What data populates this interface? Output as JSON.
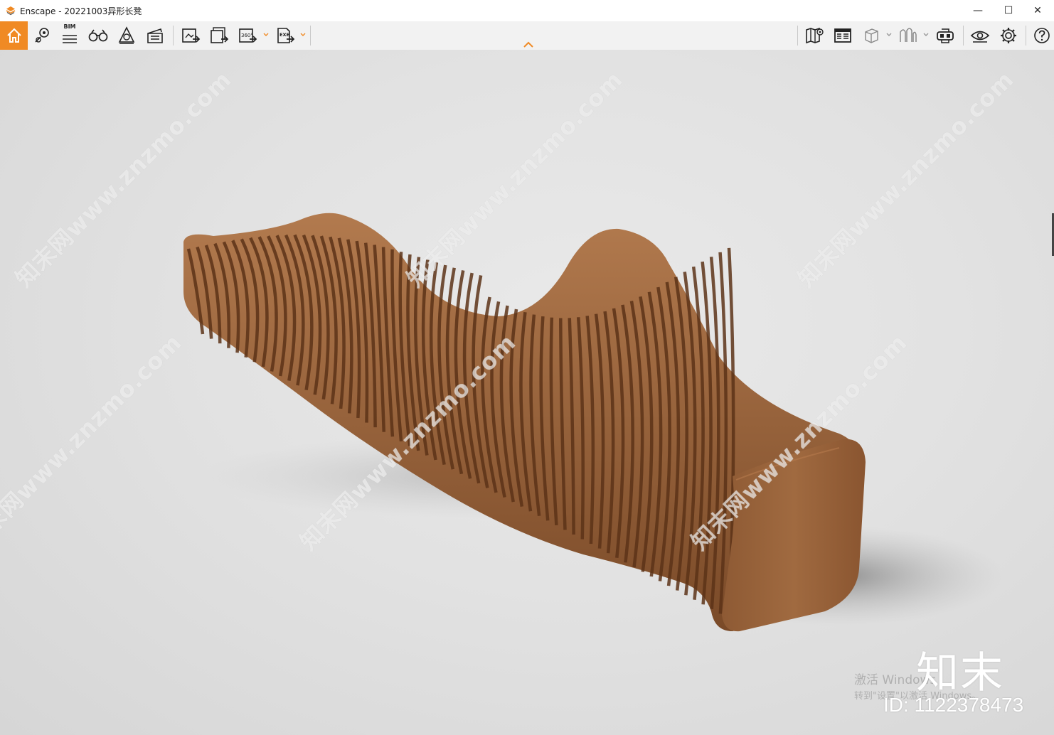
{
  "window": {
    "title": "Enscape - 20221003异形长凳",
    "controls": {
      "minimize": "—",
      "maximize": "☐",
      "close": "✕"
    }
  },
  "toolbar": {
    "left": [
      {
        "id": "home",
        "icon": "home-icon",
        "active": true
      },
      {
        "id": "location",
        "icon": "map-pin-icon"
      },
      {
        "id": "bim",
        "icon": "bim-icon",
        "label": "BIM"
      },
      {
        "id": "binoculars",
        "icon": "binoculars-icon"
      },
      {
        "id": "asset",
        "icon": "asset-library-icon"
      },
      {
        "id": "video",
        "icon": "clapperboard-icon"
      },
      {
        "id": "render-image",
        "icon": "render-image-icon"
      },
      {
        "id": "batch-render",
        "icon": "batch-render-icon"
      },
      {
        "id": "panorama",
        "icon": "panorama-icon",
        "label": "360°"
      },
      {
        "id": "exe-export",
        "icon": "export-exe-icon",
        "label": "EXE"
      }
    ],
    "right": [
      {
        "id": "map",
        "icon": "map-icon"
      },
      {
        "id": "views",
        "icon": "views-manager-icon"
      },
      {
        "id": "cube",
        "icon": "cube-icon"
      },
      {
        "id": "sketch",
        "icon": "sketch-mode-icon"
      },
      {
        "id": "vr",
        "icon": "vr-headset-icon"
      },
      {
        "id": "visual-settings",
        "icon": "eye-icon"
      },
      {
        "id": "settings",
        "icon": "gear-icon"
      },
      {
        "id": "help",
        "icon": "help-icon"
      }
    ]
  },
  "accent_color": "#f08a24",
  "viewport": {
    "watermark_text": "知末网www.znzmo.com",
    "activation_line1": "激活 Windows",
    "activation_line2": "转到\"设置\"以激活 Windows。",
    "brand": "知末",
    "id_label": "ID: 1122378473"
  }
}
